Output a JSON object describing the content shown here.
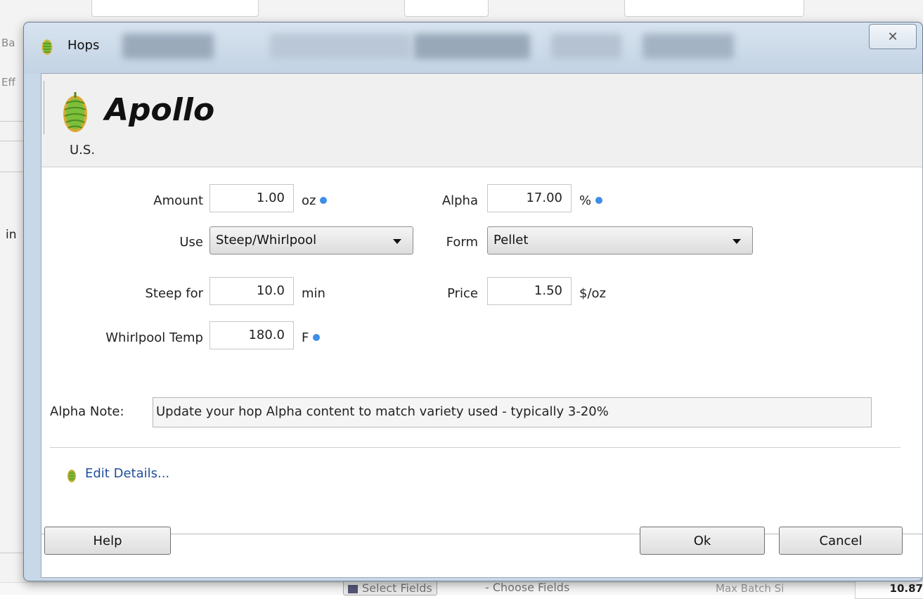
{
  "dialog": {
    "title": "Hops",
    "close_glyph": "✕"
  },
  "hop": {
    "name": "Apollo",
    "origin": "U.S."
  },
  "form": {
    "amount": {
      "label": "Amount",
      "value": "1.00",
      "unit": "oz"
    },
    "alpha": {
      "label": "Alpha",
      "value": "17.00",
      "unit": "%"
    },
    "use": {
      "label": "Use",
      "selected": "Steep/Whirlpool"
    },
    "form_type": {
      "label": "Form",
      "selected": "Pellet"
    },
    "steep_for": {
      "label": "Steep for",
      "value": "10.0",
      "unit": "min"
    },
    "price": {
      "label": "Price",
      "value": "1.50",
      "unit": "$/oz"
    },
    "whirlpool_temp": {
      "label": "Whirlpool Temp",
      "value": "180.0",
      "unit": "F"
    },
    "alpha_note": {
      "label": "Alpha Note:",
      "value": "Update your hop Alpha content to match variety used - typically 3-20%"
    }
  },
  "actions": {
    "edit_details": "Edit Details...",
    "help": "Help",
    "ok": "Ok",
    "cancel": "Cancel"
  },
  "background": {
    "left_fragments": [
      "Ba",
      "Eff",
      "in"
    ],
    "bottom_button": "Select Fields",
    "bottom_text_1": "- Choose Fields",
    "bottom_text_2": "Max Batch Si",
    "bottom_value": "10.87"
  },
  "colors": {
    "info_dot": "#3d8ee6",
    "link": "#1f4e9e",
    "hop_green": "#7cbf3a"
  },
  "icons": {
    "title_icon": "hop-icon",
    "header_icon": "hop-icon",
    "edit_icon": "hop-icon",
    "close_icon": "close-icon",
    "dropdown_icon": "chevron-down-icon",
    "info_icon": "info-dot-icon"
  }
}
